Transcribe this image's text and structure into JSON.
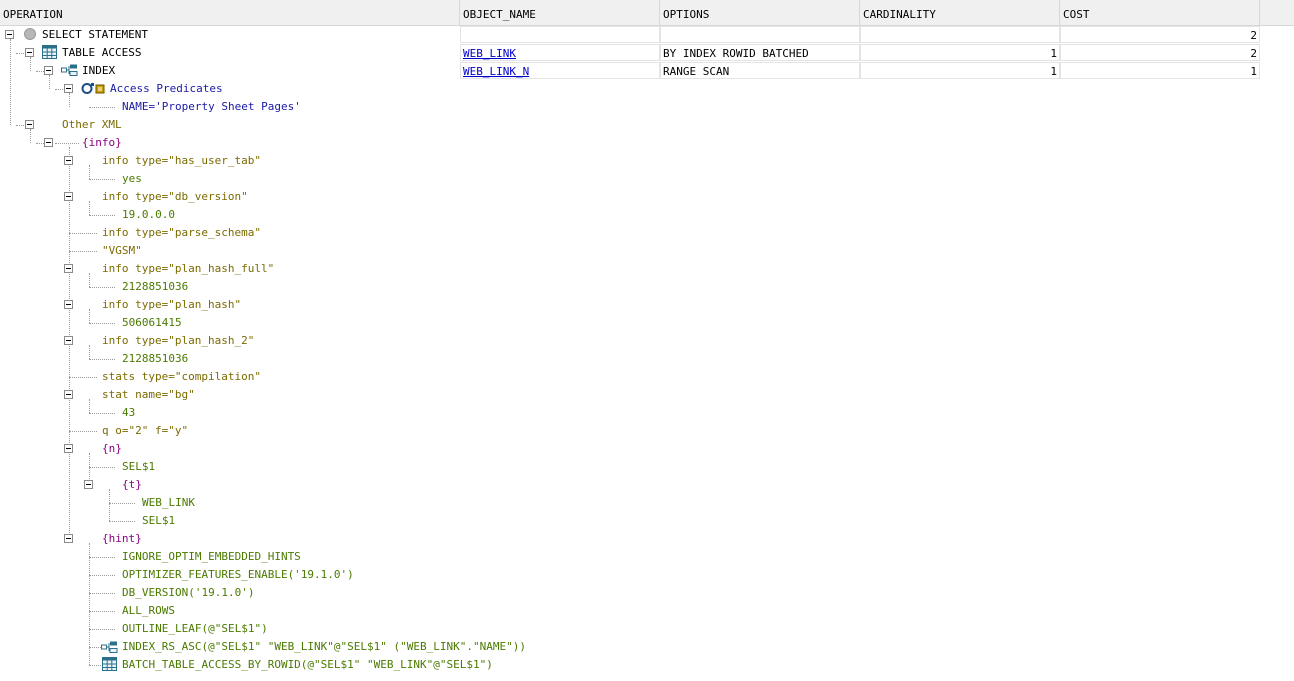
{
  "columns": {
    "operation": "OPERATION",
    "object_name": "OBJECT_NAME",
    "options": "OPTIONS",
    "cardinality": "CARDINALITY",
    "cost": "COST"
  },
  "plan_rows": [
    {
      "operation": "SELECT STATEMENT",
      "object_name": "",
      "options": "",
      "cardinality": "",
      "cost": "2"
    },
    {
      "operation": "TABLE ACCESS",
      "object_name": "WEB_LINK",
      "options": "BY INDEX ROWID BATCHED",
      "cardinality": "1",
      "cost": "2"
    },
    {
      "operation": "INDEX",
      "object_name": "WEB_LINK_N",
      "options": "RANGE SCAN",
      "cardinality": "1",
      "cost": "1"
    }
  ],
  "access_predicates": {
    "label": "Access Predicates",
    "value": "NAME='Property Sheet Pages'"
  },
  "other_xml": {
    "label": "Other XML",
    "info_tag": "{info}",
    "entries": [
      {
        "key": "info type=\"has_user_tab\"",
        "value": "yes"
      },
      {
        "key": "info type=\"db_version\"",
        "value": "19.0.0.0"
      },
      {
        "key": "info type=\"parse_schema\"",
        "value": ""
      },
      {
        "key": "\"VGSM\"",
        "value": ""
      },
      {
        "key": "info type=\"plan_hash_full\"",
        "value": "2128851036"
      },
      {
        "key": "info type=\"plan_hash\"",
        "value": "506061415"
      },
      {
        "key": "info type=\"plan_hash_2\"",
        "value": "2128851036"
      },
      {
        "key": "stats type=\"compilation\"",
        "value": ""
      },
      {
        "key": "stat name=\"bg\"",
        "value": "43"
      },
      {
        "key": "q o=\"2\" f=\"y\"",
        "value": ""
      }
    ],
    "n_tag": "{n}",
    "n_value": "SEL$1",
    "t_tag": "{t}",
    "t_values": [
      "WEB_LINK",
      "SEL$1"
    ],
    "hint_tag": "{hint}",
    "hints": [
      "IGNORE_OPTIM_EMBEDDED_HINTS",
      "OPTIMIZER_FEATURES_ENABLE('19.1.0')",
      "DB_VERSION('19.1.0')",
      "ALL_ROWS",
      "OUTLINE_LEAF(@\"SEL$1\")",
      "INDEX_RS_ASC(@\"SEL$1\" \"WEB_LINK\"@\"SEL$1\" (\"WEB_LINK\".\"NAME\"))",
      "BATCH_TABLE_ACCESS_BY_ROWID(@\"SEL$1\" \"WEB_LINK\"@\"SEL$1\")"
    ]
  },
  "colors": {
    "xml_text": "#7b6b00",
    "xml_value": "#4b7a00",
    "xml_tag": "#8a0084",
    "predicate": "#1a1aa6",
    "link": "#0000cc"
  },
  "icons": [
    "statement-circle-icon",
    "table-access-icon",
    "index-icon",
    "filter-icon",
    "table-access-icon"
  ]
}
